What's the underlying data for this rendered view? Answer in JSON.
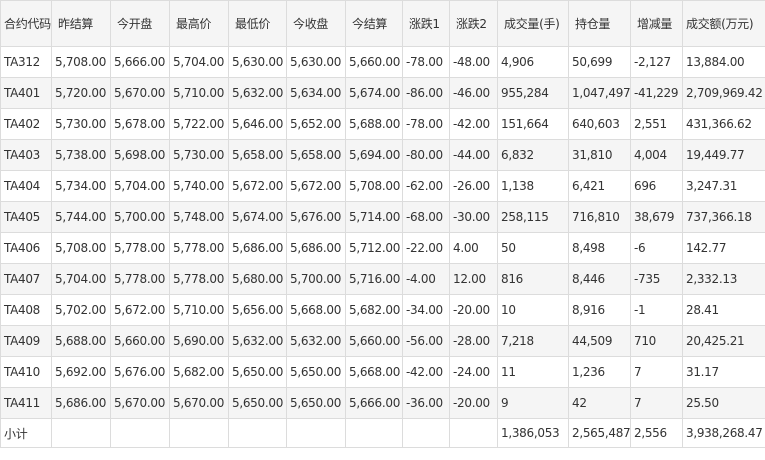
{
  "headers": [
    "合约代码",
    "昨结算",
    "今开盘",
    "最高价",
    "最低价",
    "今收盘",
    "今结算",
    "涨跌1",
    "涨跌2",
    "成交量(手)",
    "持仓量",
    "增减量",
    "成交额(万元)"
  ],
  "rows": [
    [
      "TA312",
      "5,708.00",
      "5,666.00",
      "5,704.00",
      "5,630.00",
      "5,630.00",
      "5,660.00",
      "-78.00",
      "-48.00",
      "4,906",
      "50,699",
      "-2,127",
      "13,884.00"
    ],
    [
      "TA401",
      "5,720.00",
      "5,670.00",
      "5,710.00",
      "5,632.00",
      "5,634.00",
      "5,674.00",
      "-86.00",
      "-46.00",
      "955,284",
      "1,047,497",
      "-41,229",
      "2,709,969.42"
    ],
    [
      "TA402",
      "5,730.00",
      "5,678.00",
      "5,722.00",
      "5,646.00",
      "5,652.00",
      "5,688.00",
      "-78.00",
      "-42.00",
      "151,664",
      "640,603",
      "2,551",
      "431,366.62"
    ],
    [
      "TA403",
      "5,738.00",
      "5,698.00",
      "5,730.00",
      "5,658.00",
      "5,658.00",
      "5,694.00",
      "-80.00",
      "-44.00",
      "6,832",
      "31,810",
      "4,004",
      "19,449.77"
    ],
    [
      "TA404",
      "5,734.00",
      "5,704.00",
      "5,740.00",
      "5,672.00",
      "5,672.00",
      "5,708.00",
      "-62.00",
      "-26.00",
      "1,138",
      "6,421",
      "696",
      "3,247.31"
    ],
    [
      "TA405",
      "5,744.00",
      "5,700.00",
      "5,748.00",
      "5,674.00",
      "5,676.00",
      "5,714.00",
      "-68.00",
      "-30.00",
      "258,115",
      "716,810",
      "38,679",
      "737,366.18"
    ],
    [
      "TA406",
      "5,708.00",
      "5,778.00",
      "5,778.00",
      "5,686.00",
      "5,686.00",
      "5,712.00",
      "-22.00",
      "4.00",
      "50",
      "8,498",
      "-6",
      "142.77"
    ],
    [
      "TA407",
      "5,704.00",
      "5,778.00",
      "5,778.00",
      "5,680.00",
      "5,700.00",
      "5,716.00",
      "-4.00",
      "12.00",
      "816",
      "8,446",
      "-735",
      "2,332.13"
    ],
    [
      "TA408",
      "5,702.00",
      "5,672.00",
      "5,710.00",
      "5,656.00",
      "5,668.00",
      "5,682.00",
      "-34.00",
      "-20.00",
      "10",
      "8,916",
      "-1",
      "28.41"
    ],
    [
      "TA409",
      "5,688.00",
      "5,660.00",
      "5,690.00",
      "5,632.00",
      "5,632.00",
      "5,660.00",
      "-56.00",
      "-28.00",
      "7,218",
      "44,509",
      "710",
      "20,425.21"
    ],
    [
      "TA410",
      "5,692.00",
      "5,676.00",
      "5,682.00",
      "5,650.00",
      "5,650.00",
      "5,668.00",
      "-42.00",
      "-24.00",
      "11",
      "1,236",
      "7",
      "31.17"
    ],
    [
      "TA411",
      "5,686.00",
      "5,670.00",
      "5,670.00",
      "5,650.00",
      "5,650.00",
      "5,666.00",
      "-36.00",
      "-20.00",
      "9",
      "42",
      "7",
      "25.50"
    ]
  ],
  "total": [
    "小计",
    "",
    "",
    "",
    "",
    "",
    "",
    "",
    "",
    "1,386,053",
    "2,565,487",
    "2,556",
    "3,938,268.47"
  ]
}
